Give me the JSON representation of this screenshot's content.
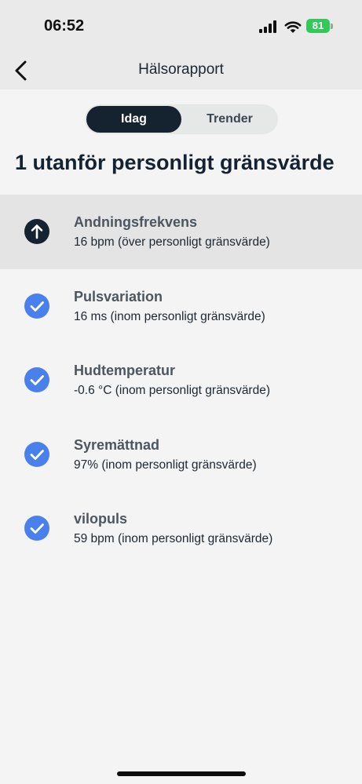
{
  "status": {
    "time": "06:52",
    "battery": "81"
  },
  "nav": {
    "title": "Hälsorapport"
  },
  "tabs": [
    {
      "label": "Idag",
      "selected": true
    },
    {
      "label": "Trender",
      "selected": false
    }
  ],
  "summary": "1 utanför personligt gränsvärde",
  "metrics": [
    {
      "name": "Andningsfrekvens",
      "value": "16 bpm (över personligt gränsvärde)",
      "status_icon": "arrow-up-icon",
      "icon_color": "#152331"
    },
    {
      "name": "Pulsvariation",
      "value": "16 ms (inom personligt gränsvärde)",
      "status_icon": "check-icon",
      "icon_color": "#4a80eb"
    },
    {
      "name": "Hudtemperatur",
      "value": "-0.6 °C (inom personligt gränsvärde)",
      "status_icon": "check-icon",
      "icon_color": "#4a80eb"
    },
    {
      "name": "Syremättnad",
      "value": "97% (inom personligt gränsvärde)",
      "status_icon": "check-icon",
      "icon_color": "#4a80eb"
    },
    {
      "name": "vilopuls",
      "value": "59 bpm (inom personligt gränsvärde)",
      "status_icon": "check-icon",
      "icon_color": "#4a80eb"
    }
  ],
  "colors": {
    "accent_dark": "#152331",
    "check_blue": "#4a80eb",
    "battery_green": "#34c759"
  }
}
